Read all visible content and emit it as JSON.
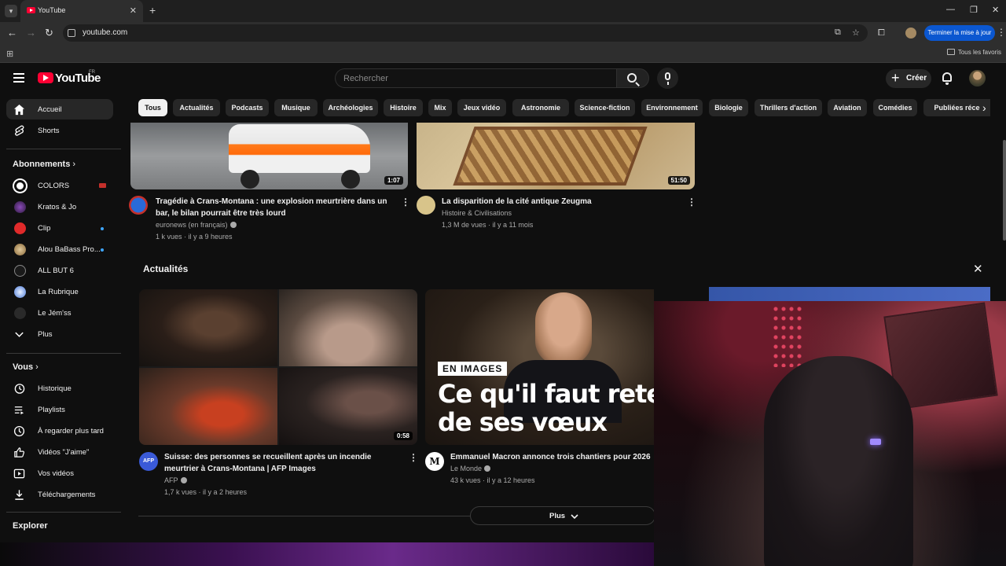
{
  "browser": {
    "tab_title": "YouTube",
    "url": "youtube.com",
    "update_button": "Terminer la mise à jour",
    "all_bookmarks": "Tous les favoris"
  },
  "header": {
    "logo_text": "YouTube",
    "country": "FR",
    "search_placeholder": "Rechercher",
    "create_label": "Créer"
  },
  "sidebar": {
    "main": [
      {
        "label": "Accueil",
        "icon": "home-icon"
      },
      {
        "label": "Shorts",
        "icon": "shorts-icon"
      }
    ],
    "subscriptions_heading": "Abonnements",
    "subscriptions": [
      {
        "label": "COLORS",
        "badge": "live"
      },
      {
        "label": "Kratos & Jo"
      },
      {
        "label": "Clip",
        "badge": "new"
      },
      {
        "label": "Alou BaBass Pro...",
        "badge": "new"
      },
      {
        "label": "ALL BUT 6"
      },
      {
        "label": "La Rubrique"
      },
      {
        "label": "Le Jém'ss"
      },
      {
        "label": "Plus"
      }
    ],
    "you_heading": "Vous",
    "you_items": [
      {
        "label": "Historique",
        "icon": "history-icon"
      },
      {
        "label": "Playlists",
        "icon": "playlists-icon"
      },
      {
        "label": "À regarder plus tard",
        "icon": "watch-later-icon"
      },
      {
        "label": "Vidéos \"J'aime\"",
        "icon": "like-icon"
      },
      {
        "label": "Vos vidéos",
        "icon": "your-videos-icon"
      },
      {
        "label": "Téléchargements",
        "icon": "download-icon"
      }
    ],
    "explore_heading": "Explorer"
  },
  "chips": [
    "Tous",
    "Actualités",
    "Podcasts",
    "Musique",
    "Archéologies",
    "Histoire",
    "Mix",
    "Jeux vidéo",
    "Astronomie",
    "Science-fiction",
    "Environnement",
    "Biologie",
    "Thrillers d'action",
    "Aviation",
    "Comédies",
    "Publiées réce"
  ],
  "videos_top": [
    {
      "title_line1": "Tragédie à Crans-Montana : une explosion meurtrière dans un",
      "title_line2": "bar, le bilan pourrait être très lourd",
      "channel": "euronews (en français)",
      "stats": "1 k vues · il y a 9 heures",
      "duration": "1:07"
    },
    {
      "title_line1": "La disparition de la cité antique Zeugma",
      "title_line2": "",
      "channel": "Histoire & Civilisations",
      "stats": "1,3 M de vues · il y a 11 mois",
      "duration": "51:50"
    }
  ],
  "news_shelf": {
    "title": "Actualités",
    "more_label": "Plus",
    "videos": [
      {
        "title_line1": "Suisse: des personnes se recueillent après un incendie",
        "title_line2": "meurtrier à Crans-Montana | AFP Images",
        "channel": "AFP",
        "avatar_text": "AFP",
        "stats": "1,7 k vues · il y a 2 heures",
        "duration": "0:58"
      },
      {
        "title_line1": "Emmanuel Macron annonce trois chantiers pour 2026",
        "title_line2": "",
        "channel": "Le Monde",
        "avatar_text": "M",
        "stats": "43 k vues · il y a 12 heures",
        "thumb_tag": "EN IMAGES",
        "thumb_headline1": "Ce qu'il faut reter",
        "thumb_headline2": "de ses vœux"
      }
    ]
  },
  "colors": {
    "accent_red": "#ff0033",
    "background": "#0f0f0f",
    "chip_bg": "#272727",
    "update_blue": "#0b57d0"
  }
}
